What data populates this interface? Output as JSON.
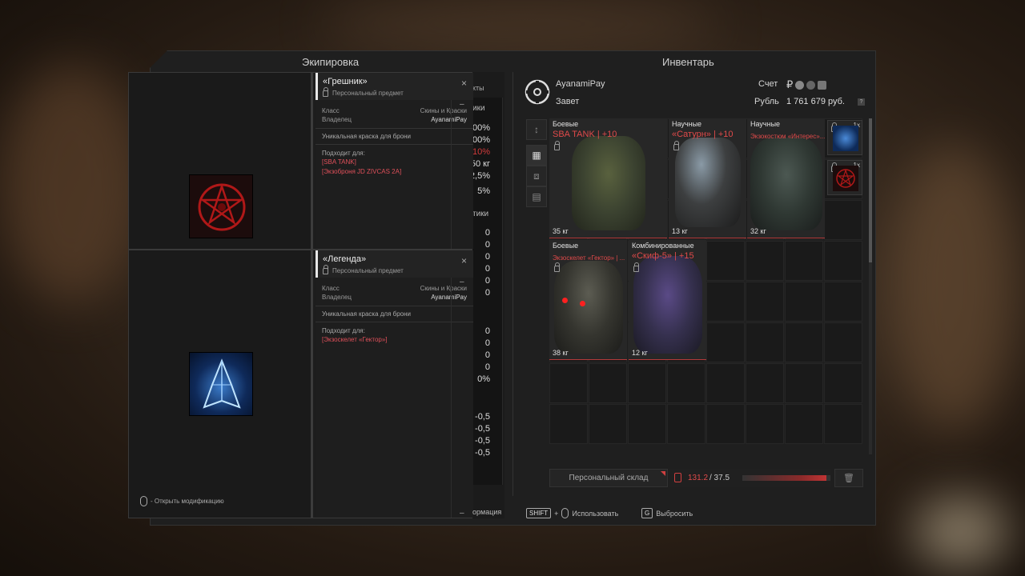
{
  "titles": {
    "equipment": "Экипировка",
    "inventory": "Инвентарь"
  },
  "colors": {
    "accent_red": "#d04040",
    "item_name_red": "#e04a4a",
    "panel_bg": "#1f1f1f"
  },
  "stats": {
    "header_1": "ики",
    "header_2": "тики",
    "header_3": "кты",
    "values_top": [
      "00%",
      "00%",
      "10%",
      "50 кг",
      "2,5%",
      "5%"
    ],
    "values_mid": [
      "0",
      "0",
      "0",
      "0",
      "0",
      "0"
    ],
    "values_low": [
      "0",
      "0",
      "0",
      "0",
      "0%"
    ],
    "values_bottom": [
      "-0,5",
      "-0,5",
      "-0,5",
      "-0,5"
    ]
  },
  "card1": {
    "name": "«Грешник»",
    "subtitle": "Персональный предмет",
    "class_label": "Класс",
    "class_value": "Скины и Краски",
    "owner_label": "Владелец",
    "owner_value": "AyanamiPay",
    "description": "Уникальная краска для брони",
    "fits_label": "Подходит для:",
    "fits": [
      "[SBA TANK]",
      "[Экзоброня JD ZIVCAS 2A]"
    ],
    "close_icon": "×",
    "scroll_icon": "–"
  },
  "card2": {
    "name": "«Легенда»",
    "subtitle": "Персональный предмет",
    "class_label": "Класс",
    "class_value": "Скины и Краски",
    "owner_label": "Владелец",
    "owner_value": "AyanamiPay",
    "description": "Уникальная краска для брони",
    "fits_label": "Подходит для:",
    "fits": [
      "[Экзоскелет «Гектор»]"
    ],
    "close_icon": "×",
    "scroll_top": "–",
    "scroll_bottom": "–"
  },
  "account": {
    "player": "AyanamiPay",
    "clan": "Завет",
    "account_label": "Счет",
    "currency_label": "Рубль",
    "balance": "1 761 679 руб.",
    "currency_symbol": "₽",
    "help": "?"
  },
  "tools": {
    "sort": "↕",
    "grid": "▦",
    "filter": "⧈",
    "box": "▤"
  },
  "items": [
    {
      "category": "Боевые",
      "name": "SBA TANK | +10",
      "weight": "35 кг"
    },
    {
      "category": "Научные",
      "name": "«Сатурн» | +10",
      "weight": "13 кг"
    },
    {
      "category": "Научные",
      "name": "Экзокостюм «Интерес»...",
      "weight": "32 кг"
    },
    {
      "category": "Боевые",
      "name": "Экзоскелет «Гектор» | ...",
      "weight": "38 кг"
    },
    {
      "category": "Комбинированные",
      "name": "«Скиф-5» | +15",
      "weight": "12 кг"
    }
  ],
  "mini_items": [
    {
      "qty": "1x"
    },
    {
      "qty": "1x"
    }
  ],
  "storage": {
    "button": "Персональный склад",
    "weight_current": "131.2",
    "weight_max": "/  37.5",
    "weight_fraction": 0.95,
    "trash": "🗑"
  },
  "hints": {
    "info": "ормация",
    "shift": "SHIFT",
    "plus": "+",
    "use": "Использовать",
    "g_key": "G",
    "drop": "Выбросить",
    "open_mod": "- Открыть модификацию"
  }
}
